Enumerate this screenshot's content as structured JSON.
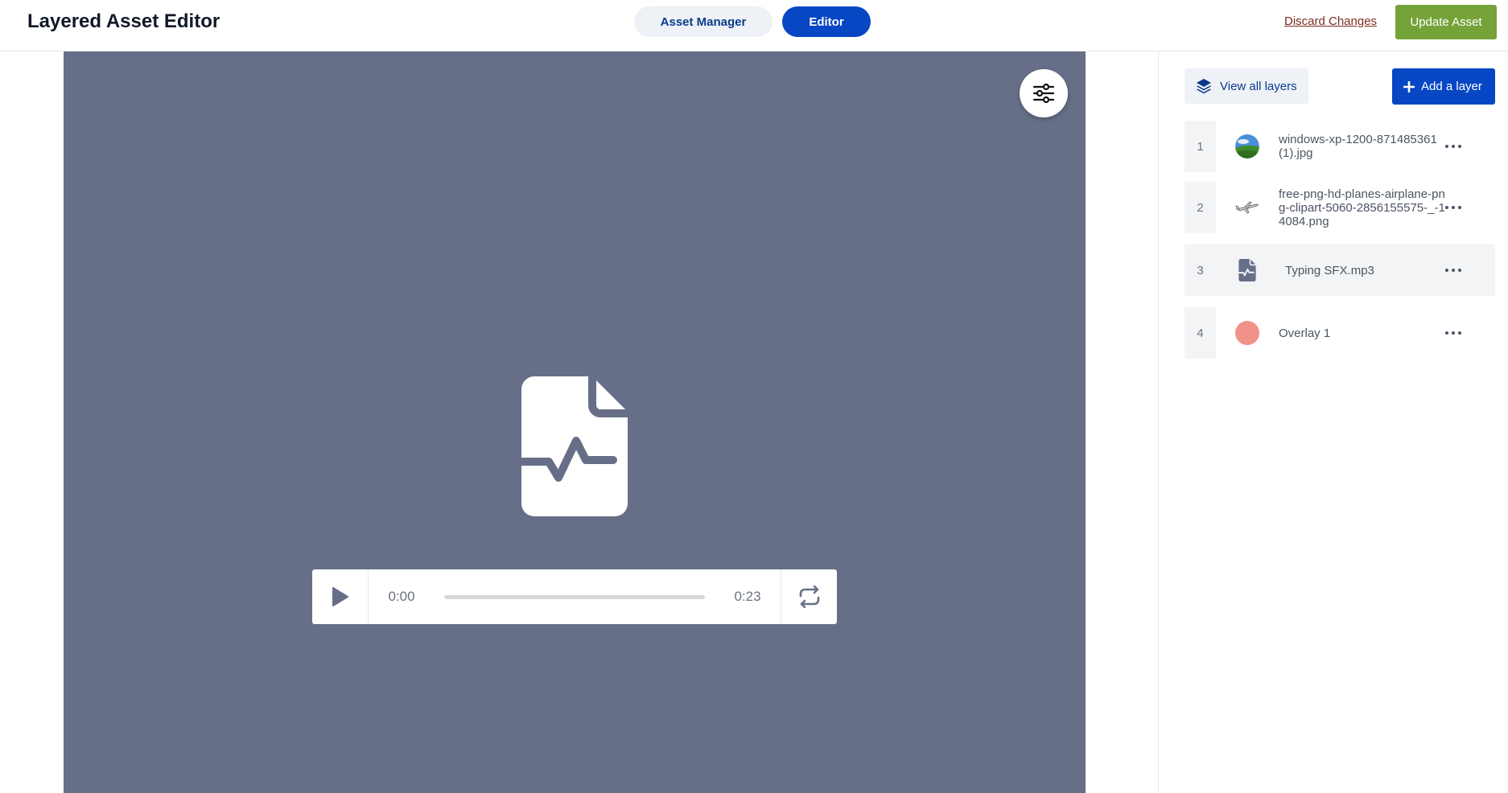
{
  "app": {
    "title": "Layered Asset Editor"
  },
  "nav": {
    "asset_manager_label": "Asset Manager",
    "editor_label": "Editor"
  },
  "actions": {
    "discard_label": "Discard Changes",
    "update_label": "Update Asset"
  },
  "player": {
    "current_time": "0:00",
    "duration": "0:23",
    "progress": 0
  },
  "panel": {
    "view_all_label": "View all layers",
    "add_layer_label": "Add a layer",
    "layers": [
      {
        "index": "1",
        "name": "windows-xp-1200-871485361 (1).jpg",
        "thumb": "landscape-thumb",
        "active": false
      },
      {
        "index": "2",
        "name": "free-png-hd-planes-airplane-png-clipart-5060-2856155575-_-14084.png",
        "thumb": "airplane-thumb",
        "active": false
      },
      {
        "index": "3",
        "name": "Typing SFX.mp3",
        "thumb": "audio-file-icon",
        "active": true
      },
      {
        "index": "4",
        "name": "Overlay 1",
        "thumb": "color-swatch",
        "active": false
      }
    ]
  },
  "colors": {
    "canvas_bg": "#676f88",
    "primary": "#0747c4",
    "update_green": "#75a33a",
    "discard_text": "#7a2e1e",
    "overlay_swatch": "#f0918a"
  }
}
